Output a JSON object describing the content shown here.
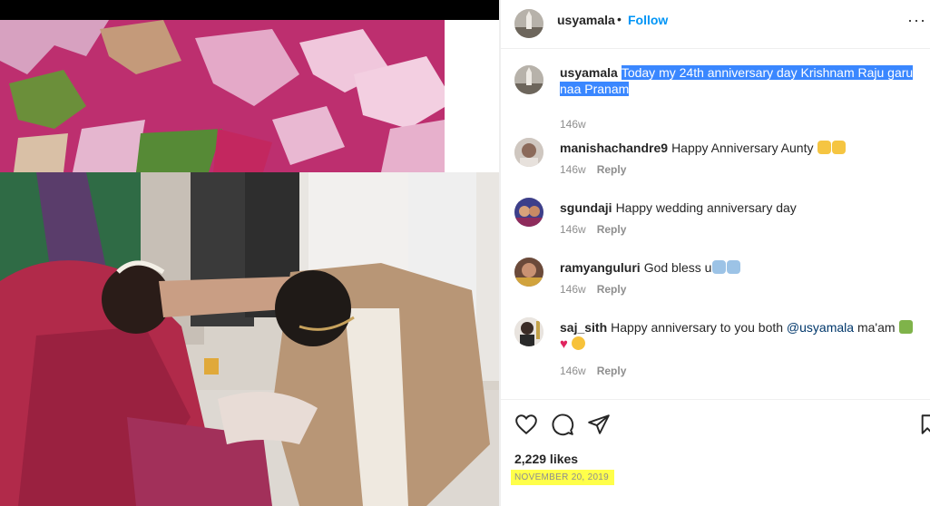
{
  "post": {
    "author": "usyamala",
    "follow_label": "Follow",
    "separator": "•",
    "more_label": "···"
  },
  "caption": {
    "author": "usyamala",
    "text_line1": "Today my 24th anniversary day Krishnam Raju garu",
    "text_line2": "naa Pranam",
    "age": "146w"
  },
  "comments": [
    {
      "user": "manishachandre9",
      "text": "Happy Anniversary Aunty",
      "emojis": [
        "folded-hands",
        "folded-hands"
      ],
      "age": "146w",
      "reply_label": "Reply"
    },
    {
      "user": "sgundaji",
      "text": "Happy wedding anniversary day",
      "emojis": [],
      "age": "146w",
      "reply_label": "Reply"
    },
    {
      "user": "ramyanguluri",
      "text": "God bless u",
      "emojis": [
        "folded-hands",
        "folded-hands"
      ],
      "age": "146w",
      "reply_label": "Reply"
    },
    {
      "user": "saj_sith",
      "text": "Happy anniversary to you both",
      "mention": "@usyamala",
      "text_after": "ma'am",
      "emojis": [
        "bouquet",
        "heart",
        "heart-eyes"
      ],
      "age": "146w",
      "reply_label": "Reply"
    }
  ],
  "footer": {
    "likes": "2,229 likes",
    "date": "NOVEMBER 20, 2019"
  },
  "colors": {
    "accent": "#0095f6",
    "selection": "#3a87ff",
    "date_highlight": "#ffff4a",
    "muted": "#8e8e8e"
  },
  "icons": [
    "heart-icon",
    "comment-icon",
    "share-icon",
    "bookmark-icon",
    "more-icon",
    "comment-like-icon"
  ]
}
